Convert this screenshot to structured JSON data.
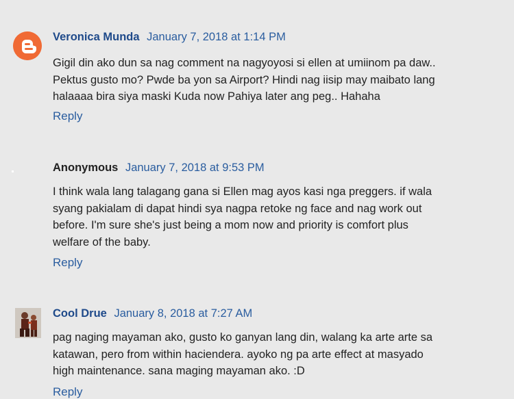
{
  "comments": [
    {
      "author": "Veronica Munda",
      "avatar_icon": "blogger-icon",
      "date": "January 7, 2018 at 1:14 PM",
      "lines": [
        "Gigil din ako dun sa nag comment na nagyoyosi si ellen at umiinom pa daw..",
        "Pektus gusto mo? Pwde ba yon sa Airport? Hindi nag iisip may maibato lang",
        "halaaaa bira siya maski Kuda now Pahiya later ang peg.. Hahaha"
      ],
      "reply": "Reply"
    },
    {
      "author": "Anonymous",
      "avatar_icon": "",
      "date": "January 7, 2018 at 9:53 PM",
      "lines": [
        "I think wala lang talagang gana si Ellen mag ayos kasi nga preggers. if wala",
        "syang pakialam di dapat hindi sya nagpa retoke ng face and nag work out",
        "before. I'm sure she's just being a mom now and priority is comfort plus",
        "welfare of the baby."
      ],
      "reply": "Reply"
    },
    {
      "author": "Cool Drue",
      "avatar_icon": "user-photo",
      "date": "January 8, 2018 at 7:27 AM",
      "lines": [
        "pag naging mayaman ako, gusto ko ganyan lang din, walang ka arte arte sa",
        "katawan, pero from within haciendera. ayoko ng pa arte effect at masyado",
        "high maintenance. sana maging mayaman ako. :D"
      ],
      "reply": "Reply"
    }
  ],
  "colors": {
    "background": "#e9e9e9",
    "author_link": "#1f4a8a",
    "link": "#2a5d9f",
    "blogger_orange": "#f06a35"
  }
}
